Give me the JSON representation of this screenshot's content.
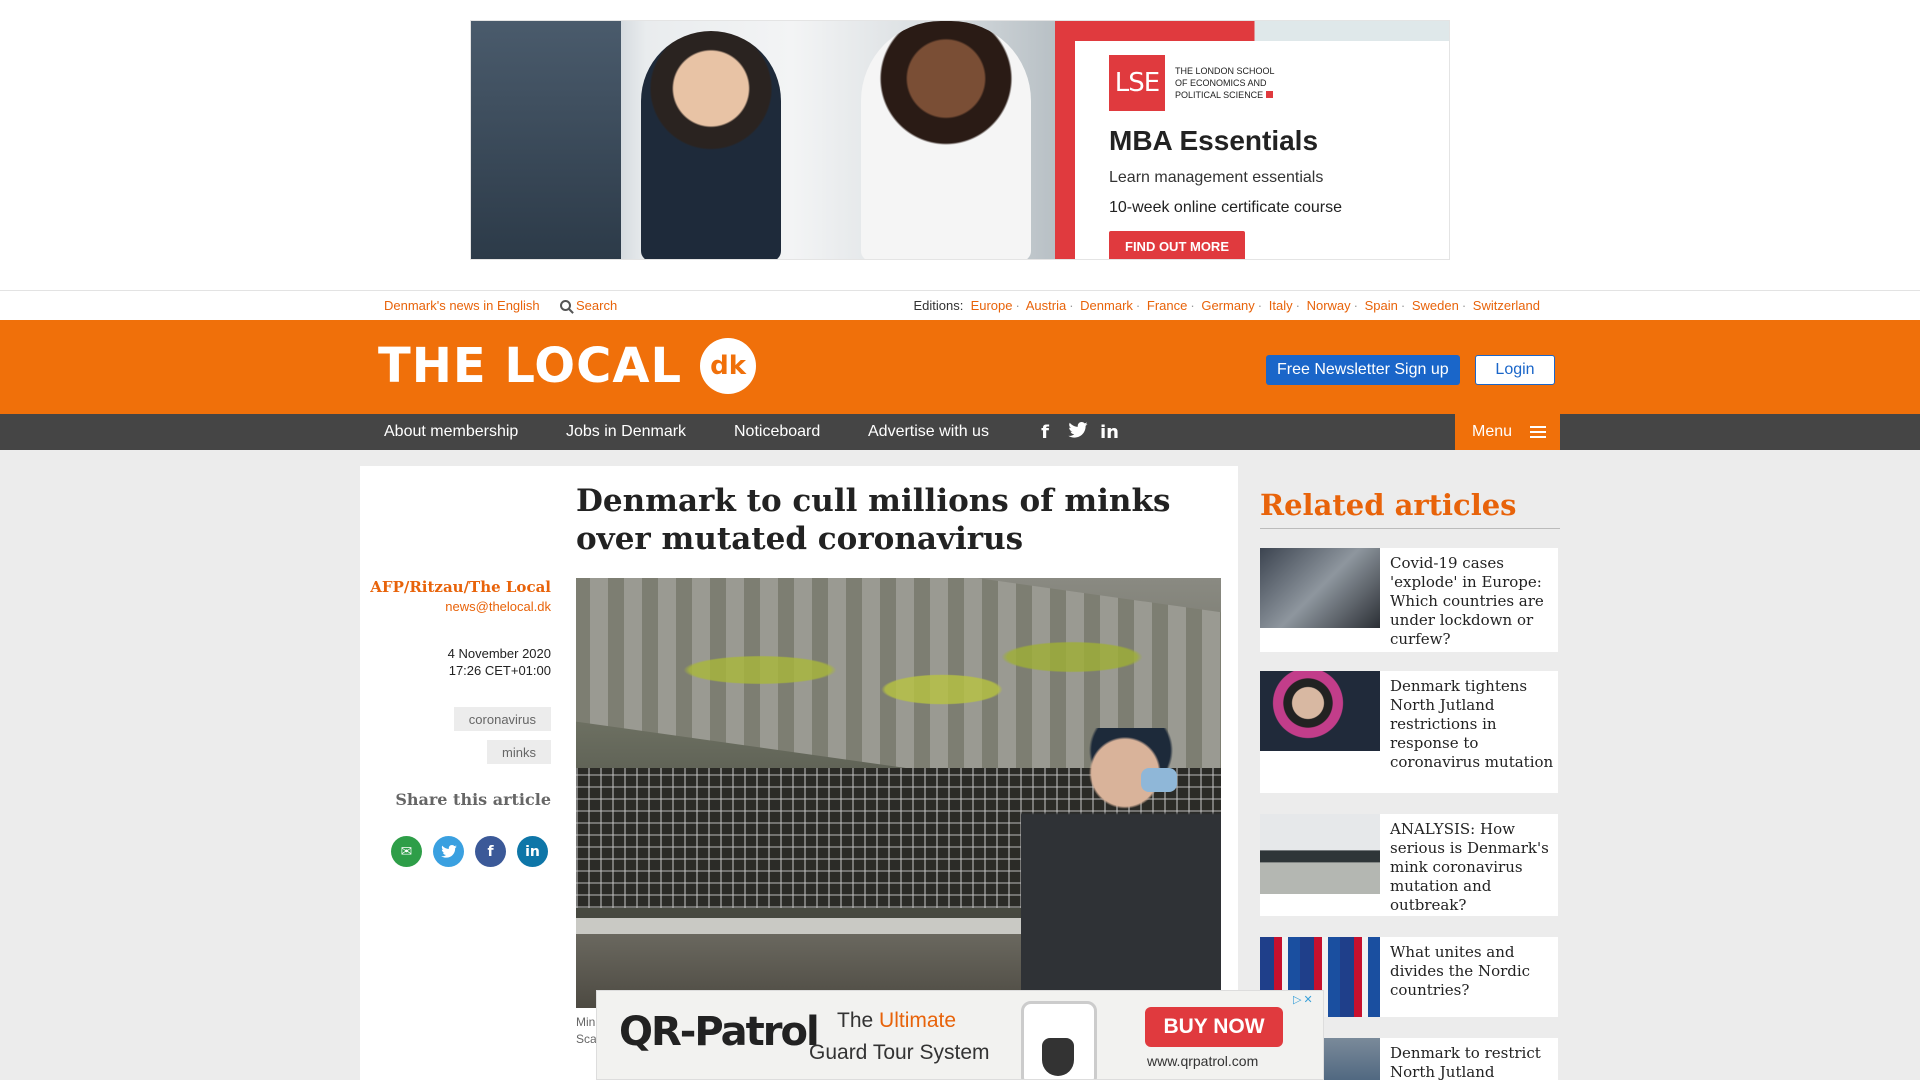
{
  "top_ad": {
    "school_mark": "LSE",
    "school_name_lines": [
      "THE LONDON SCHOOL",
      "OF ECONOMICS AND",
      "POLITICAL SCIENCE"
    ],
    "headline": "MBA Essentials",
    "line1": "Learn management essentials",
    "line2": "10-week online certificate course",
    "cta": "FIND OUT MORE"
  },
  "utility": {
    "tagline": "Denmark's news in English",
    "search_label": "Search",
    "editions_label": "Editions:",
    "editions": [
      "Europe",
      "Austria",
      "Denmark",
      "France",
      "Germany",
      "Italy",
      "Norway",
      "Spain",
      "Sweden",
      "Switzerland"
    ]
  },
  "header": {
    "logo_text": "THE LOCAL",
    "logo_badge": "dk",
    "newsletter_label": "Free Newsletter Sign up",
    "login_label": "Login"
  },
  "nav": {
    "items": [
      "About membership",
      "Jobs in Denmark",
      "Noticeboard",
      "Advertise with us"
    ],
    "menu_label": "Menu"
  },
  "article": {
    "headline": "Denmark to cull millions of minks over mutated coronavirus",
    "author": "AFP/Ritzau/The Local",
    "email": "news@thelocal.dk",
    "date": "4 November 2020",
    "time": "17:26 CET+01:00",
    "tags": [
      "coronavirus",
      "minks"
    ],
    "share_title": "Share this article",
    "caption": "Min Sca"
  },
  "related": {
    "title": "Related articles",
    "items": [
      {
        "text": "Covid-19 cases 'explode' in Europe: Which countries are under lockdown or curfew?"
      },
      {
        "text": "Denmark tightens North Jutland restrictions in response to coronavirus mutation"
      },
      {
        "text": "ANALYSIS: How serious is Denmark's mink coronavirus mutation and outbreak?"
      },
      {
        "text": "What unites and divides the Nordic countries?"
      },
      {
        "text": "Denmark to restrict North Jutland"
      }
    ]
  },
  "bottom_ad": {
    "brand": "QR-Patrol",
    "tag_prefix": "The ",
    "tag_highlight": "Ultimate",
    "tag_line2": "Guard Tour System",
    "cta": "BUY NOW",
    "url": "www.qrpatrol.com"
  },
  "colors": {
    "brand_orange": "#f0700a",
    "nav_gray": "#454545",
    "newsletter_blue": "#1a66c9"
  }
}
